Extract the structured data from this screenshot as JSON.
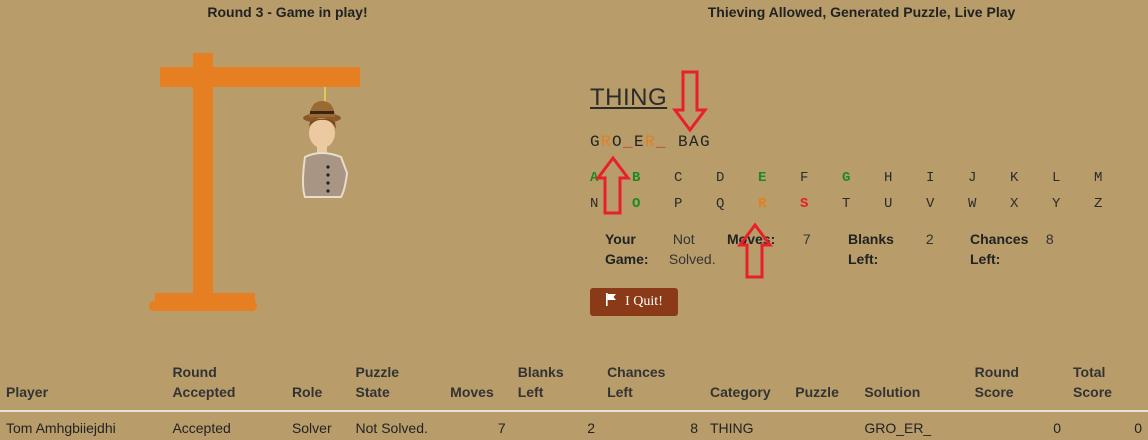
{
  "header": {
    "round_title": "Round 3 - Game in play!",
    "mode_title": "Thieving Allowed, Generated Puzzle, Live Play"
  },
  "game": {
    "category": "THING",
    "puzzle": [
      {
        "ch": "G",
        "state": "revealed"
      },
      {
        "ch": "R",
        "state": "stolen"
      },
      {
        "ch": "O",
        "state": "revealed"
      },
      {
        "ch": "_",
        "state": "blank"
      },
      {
        "ch": "E",
        "state": "revealed"
      },
      {
        "ch": "R",
        "state": "stolen"
      },
      {
        "ch": "_",
        "state": "blank"
      },
      {
        "ch": " ",
        "state": "space"
      },
      {
        "ch": "B",
        "state": "revealed"
      },
      {
        "ch": "A",
        "state": "revealed"
      },
      {
        "ch": "G",
        "state": "revealed"
      }
    ],
    "letters_row1": [
      {
        "ch": "A",
        "state": "correct"
      },
      {
        "ch": "B",
        "state": "correct"
      },
      {
        "ch": "C",
        "state": "none"
      },
      {
        "ch": "D",
        "state": "none"
      },
      {
        "ch": "E",
        "state": "correct"
      },
      {
        "ch": "F",
        "state": "none"
      },
      {
        "ch": "G",
        "state": "correct"
      },
      {
        "ch": "H",
        "state": "none"
      },
      {
        "ch": "I",
        "state": "none"
      },
      {
        "ch": "J",
        "state": "none"
      },
      {
        "ch": "K",
        "state": "none"
      },
      {
        "ch": "L",
        "state": "none"
      },
      {
        "ch": "M",
        "state": "none"
      }
    ],
    "letters_row2": [
      {
        "ch": "N",
        "state": "none"
      },
      {
        "ch": "O",
        "state": "correct"
      },
      {
        "ch": "P",
        "state": "none"
      },
      {
        "ch": "Q",
        "state": "none"
      },
      {
        "ch": "R",
        "state": "stolen"
      },
      {
        "ch": "S",
        "state": "wrong"
      },
      {
        "ch": "T",
        "state": "none"
      },
      {
        "ch": "U",
        "state": "none"
      },
      {
        "ch": "V",
        "state": "none"
      },
      {
        "ch": "W",
        "state": "none"
      },
      {
        "ch": "X",
        "state": "none"
      },
      {
        "ch": "Y",
        "state": "none"
      },
      {
        "ch": "Z",
        "state": "none"
      }
    ],
    "stats": {
      "your_game_label1": "Your",
      "your_game_label2": "Game:",
      "your_game_value1": "Not",
      "your_game_value2": "Solved.",
      "moves_label": "Moves:",
      "moves_value": "7",
      "blanks_label1": "Blanks",
      "blanks_label2": "Left:",
      "blanks_value": "2",
      "chances_label1": "Chances",
      "chances_label2": "Left:",
      "chances_value": "8"
    },
    "quit_label": "I Quit!"
  },
  "table": {
    "headers": [
      [
        "Player"
      ],
      [
        "Round",
        "Accepted"
      ],
      [
        "Role"
      ],
      [
        "Puzzle",
        "State"
      ],
      [
        "Moves"
      ],
      [
        "Blanks",
        "Left"
      ],
      [
        "Chances",
        "Left"
      ],
      [
        "Category"
      ],
      [
        "Puzzle"
      ],
      [
        "Solution"
      ],
      [
        "Round",
        "Score"
      ],
      [
        "Total",
        "Score"
      ]
    ],
    "rows": [
      [
        "Tom Amhgbiiejdhi",
        "Accepted",
        "Solver",
        "Not Solved.",
        "7",
        "2",
        "8",
        "THING",
        "",
        "GRO_ER_",
        "0",
        "0"
      ]
    ]
  },
  "colors": {
    "background": "#b89d6b",
    "gallows": "#e67e22",
    "correct": "#1e8a1e",
    "wrong": "#e02020",
    "stolen": "#e67e22",
    "quit_button": "#8b3a17",
    "annotation_arrow": "#e8202a"
  }
}
